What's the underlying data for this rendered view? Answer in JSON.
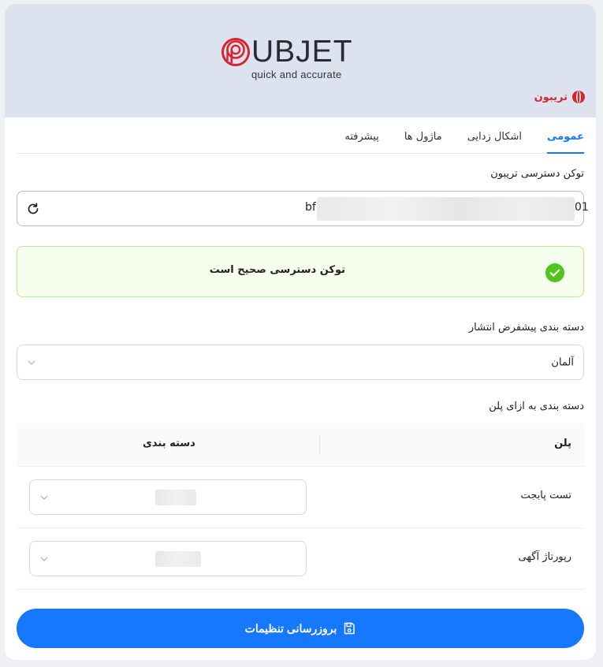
{
  "header": {
    "logo_text": "UBJET",
    "logo_tagline": "quick and accurate",
    "brand_name": "تریبون",
    "colors": {
      "header_bg": "#dde2ef",
      "logo_red": "#d9232d"
    }
  },
  "tabs": [
    {
      "label": "عمومی",
      "active": true
    },
    {
      "label": "اشکال زدایی",
      "active": false
    },
    {
      "label": "ماژول ها",
      "active": false
    },
    {
      "label": "پیشرفته",
      "active": false
    }
  ],
  "token": {
    "label": "توکن دسترسی تریبون",
    "value_prefix": "bf",
    "value_suffix": "01",
    "refresh_icon": "refresh-icon"
  },
  "alert": {
    "message": "توکن دسترسی صحیح است",
    "icon": "check-circle-icon",
    "color": "#52c41a"
  },
  "default_category": {
    "label": "دسته بندی پیشفرض انتشار",
    "value": "آلمان"
  },
  "plan_categories": {
    "label": "دسته بندی به ازای پلن",
    "columns": [
      "پلن",
      "دسته بندی"
    ],
    "rows": [
      {
        "plan": "تست پابجت",
        "category": ""
      },
      {
        "plan": "رپورتاژ آگهی",
        "category": ""
      }
    ]
  },
  "submit": {
    "label": "بروزرسانی تنظیمات",
    "icon": "save-icon",
    "color": "#1677ff"
  }
}
